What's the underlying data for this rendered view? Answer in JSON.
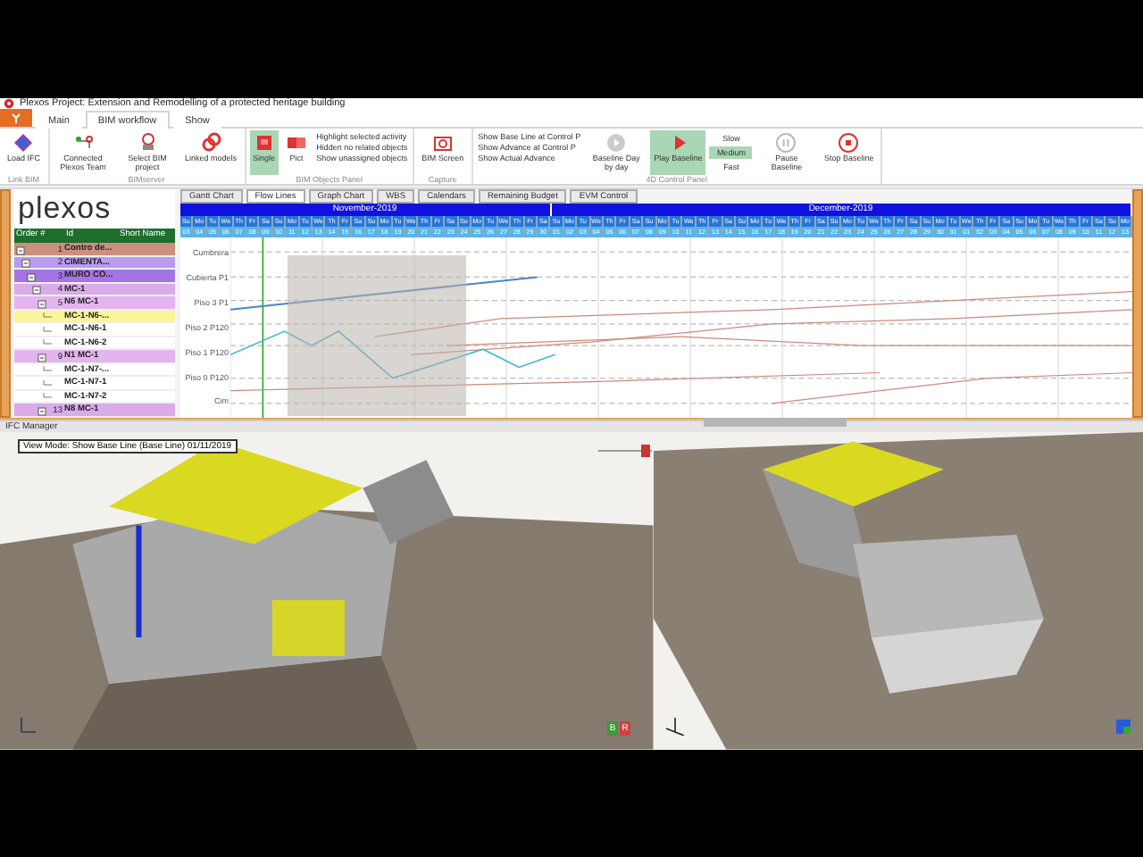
{
  "window": {
    "title": "Plexos Project: Extension and Remodelling of a protected heritage building"
  },
  "ribbon_tabs": [
    {
      "label": "Main",
      "selected": false
    },
    {
      "label": "BIM workflow",
      "selected": true
    },
    {
      "label": "Show",
      "selected": false
    }
  ],
  "ribbon_groups": [
    {
      "title": "Link BIM",
      "items": [
        {
          "kind": "large",
          "label": "Load IFC",
          "selected": false
        }
      ]
    },
    {
      "title": "BIMserver",
      "items": [
        {
          "kind": "large",
          "label": "Connected Plexos Team",
          "selected": false
        },
        {
          "kind": "large",
          "label": "Select BIM project",
          "selected": false
        },
        {
          "kind": "large",
          "label": "Linked models",
          "selected": false
        }
      ]
    },
    {
      "title": "BIM Objects Panel",
      "items": [
        {
          "kind": "large",
          "label": "Single",
          "selected": true
        },
        {
          "kind": "large",
          "label": "Pict",
          "selected": false
        },
        {
          "kind": "stack",
          "lines": [
            "Highlight selected activity",
            "Hidden no related objects",
            "Show unassigned objects"
          ]
        }
      ]
    },
    {
      "title": "Capture",
      "items": [
        {
          "kind": "large",
          "label": "BIM Screen",
          "selected": false
        }
      ]
    },
    {
      "title": "4D Control Panel",
      "items": [
        {
          "kind": "stack",
          "lines": [
            "Show Base Line at Control P",
            "Show Advance at Control P",
            "Show Actual Advance"
          ]
        },
        {
          "kind": "large",
          "label": "Baseline Day by day",
          "selected": false
        },
        {
          "kind": "large",
          "label": "Play Baseline",
          "selected": true
        },
        {
          "kind": "speed",
          "options": [
            {
              "label": "Slow",
              "selected": false
            },
            {
              "label": "Medium",
              "selected": true
            },
            {
              "label": "Fast",
              "selected": false
            }
          ]
        },
        {
          "kind": "large",
          "label": "Pause Baseline",
          "selected": false
        },
        {
          "kind": "large",
          "label": "Stop Baseline",
          "selected": false
        }
      ]
    }
  ],
  "logo": "plexos",
  "table": {
    "columns": [
      "Order #",
      "Id",
      "Short Name"
    ],
    "rows": [
      {
        "order": "1",
        "id": "Contro de...",
        "color": "#c9907e",
        "selected": false,
        "expanded": true,
        "children": [
          {
            "order": "2",
            "id": "CIMENTA...",
            "color": "#b99bf2",
            "selected": false,
            "expanded": true,
            "children": [
              {
                "order": "3",
                "id": "MURO CO...",
                "color": "#a474e2",
                "selected": false,
                "expanded": true,
                "children": [
                  {
                    "order": "4",
                    "id": "MC-1",
                    "color": "#d9abe9",
                    "selected": false,
                    "expanded": true,
                    "children": [
                      {
                        "order": "5",
                        "id": "N6 MC-1",
                        "color": "#e4b4ee",
                        "selected": false,
                        "expanded": true,
                        "children": [
                          {
                            "id": "MC-1-N6-...",
                            "selected": true
                          },
                          {
                            "id": "MC-1-N6-1",
                            "selected": false
                          },
                          {
                            "id": "MC-1-N6-2",
                            "selected": false
                          }
                        ]
                      },
                      {
                        "order": "9",
                        "id": "N1 MC-1",
                        "color": "#e4b4ee",
                        "selected": false,
                        "expanded": true,
                        "children": [
                          {
                            "id": "MC-1-N7-...",
                            "selected": false
                          },
                          {
                            "id": "MC-1-N7-1",
                            "selected": false
                          },
                          {
                            "id": "MC-1-N7-2",
                            "selected": false
                          }
                        ]
                      },
                      {
                        "order": "13",
                        "id": "N8 MC-1",
                        "color": "#d9abe9",
                        "selected": false,
                        "expanded": true
                      }
                    ]
                  }
                ]
              }
            ]
          }
        ]
      }
    ]
  },
  "chart_tabs": [
    {
      "label": "Gantt Chart",
      "selected": false
    },
    {
      "label": "Flow Lines",
      "selected": true
    },
    {
      "label": "Graph Chart",
      "selected": false
    },
    {
      "label": "WBS",
      "selected": false
    },
    {
      "label": "Calendars",
      "selected": false
    },
    {
      "label": "Remaining Budget",
      "selected": false
    },
    {
      "label": "EVM Control",
      "selected": false
    }
  ],
  "months": [
    {
      "name": "November-2019",
      "days": [
        {
          "weekday": "Su",
          "date": "03"
        },
        {
          "weekday": "Mo",
          "date": "04"
        },
        {
          "weekday": "Tu",
          "date": "05"
        },
        {
          "weekday": "We",
          "date": "06"
        },
        {
          "weekday": "Th",
          "date": "07"
        },
        {
          "weekday": "Fr",
          "date": "08"
        },
        {
          "weekday": "Sa",
          "date": "09"
        },
        {
          "weekday": "Su",
          "date": "10"
        },
        {
          "weekday": "Mo",
          "date": "11"
        },
        {
          "weekday": "Tu",
          "date": "12"
        },
        {
          "weekday": "We",
          "date": "13"
        },
        {
          "weekday": "Th",
          "date": "14"
        },
        {
          "weekday": "Fr",
          "date": "15"
        },
        {
          "weekday": "Sa",
          "date": "16"
        },
        {
          "weekday": "Su",
          "date": "17"
        },
        {
          "weekday": "Mo",
          "date": "18"
        },
        {
          "weekday": "Tu",
          "date": "19"
        },
        {
          "weekday": "We",
          "date": "20"
        },
        {
          "weekday": "Th",
          "date": "21"
        },
        {
          "weekday": "Fr",
          "date": "22"
        },
        {
          "weekday": "Sa",
          "date": "23"
        },
        {
          "weekday": "Su",
          "date": "24"
        },
        {
          "weekday": "Mo",
          "date": "25"
        },
        {
          "weekday": "Tu",
          "date": "26"
        },
        {
          "weekday": "We",
          "date": "27"
        },
        {
          "weekday": "Th",
          "date": "28"
        },
        {
          "weekday": "Fr",
          "date": "29"
        },
        {
          "weekday": "Sa",
          "date": "30"
        }
      ]
    },
    {
      "name": "December-2019",
      "days": [
        {
          "weekday": "Su",
          "date": "01"
        },
        {
          "weekday": "Mo",
          "date": "02"
        },
        {
          "weekday": "Tu",
          "date": "03"
        },
        {
          "weekday": "We",
          "date": "04"
        },
        {
          "weekday": "Th",
          "date": "05"
        },
        {
          "weekday": "Fr",
          "date": "06"
        },
        {
          "weekday": "Sa",
          "date": "07"
        },
        {
          "weekday": "Su",
          "date": "08"
        },
        {
          "weekday": "Mo",
          "date": "09"
        },
        {
          "weekday": "Tu",
          "date": "10"
        },
        {
          "weekday": "We",
          "date": "11"
        },
        {
          "weekday": "Th",
          "date": "12"
        },
        {
          "weekday": "Fr",
          "date": "13"
        },
        {
          "weekday": "Sa",
          "date": "14"
        },
        {
          "weekday": "Su",
          "date": "15"
        },
        {
          "weekday": "Mo",
          "date": "16"
        },
        {
          "weekday": "Tu",
          "date": "17"
        },
        {
          "weekday": "We",
          "date": "18"
        },
        {
          "weekday": "Th",
          "date": "19"
        },
        {
          "weekday": "Fr",
          "date": "20"
        },
        {
          "weekday": "Sa",
          "date": "21"
        },
        {
          "weekday": "Su",
          "date": "22"
        },
        {
          "weekday": "Mo",
          "date": "23"
        },
        {
          "weekday": "Tu",
          "date": "24"
        },
        {
          "weekday": "We",
          "date": "25"
        },
        {
          "weekday": "Th",
          "date": "26"
        },
        {
          "weekday": "Fr",
          "date": "27"
        },
        {
          "weekday": "Sa",
          "date": "28"
        },
        {
          "weekday": "Su",
          "date": "29"
        },
        {
          "weekday": "Mo",
          "date": "30"
        },
        {
          "weekday": "Tu",
          "date": "31"
        },
        {
          "weekday": "We",
          "date": "01"
        },
        {
          "weekday": "Th",
          "date": "02"
        },
        {
          "weekday": "Fr",
          "date": "03"
        },
        {
          "weekday": "Sa",
          "date": "04"
        },
        {
          "weekday": "Su",
          "date": "05"
        },
        {
          "weekday": "Mo",
          "date": "06"
        },
        {
          "weekday": "Tu",
          "date": "07"
        },
        {
          "weekday": "We",
          "date": "08"
        },
        {
          "weekday": "Th",
          "date": "09"
        },
        {
          "weekday": "Fr",
          "date": "10"
        },
        {
          "weekday": "Sa",
          "date": "11"
        },
        {
          "weekday": "Su",
          "date": "12"
        },
        {
          "weekday": "Mo",
          "date": "13"
        }
      ]
    }
  ],
  "flow_levels": [
    "Cumbrera",
    "Cubierta P1",
    "Piso 3 P1",
    "Piso 2 P120",
    "Piso 1 P120",
    "Piso 0 P120",
    "Cim"
  ],
  "ifc_manager": {
    "title": "IFC Manager",
    "view_mode": "View Mode: Show Base Line (Base Line) 01/11/2019",
    "zoom_slider": {
      "level": 0.85
    },
    "view_buttons": [
      "B",
      "R"
    ]
  }
}
